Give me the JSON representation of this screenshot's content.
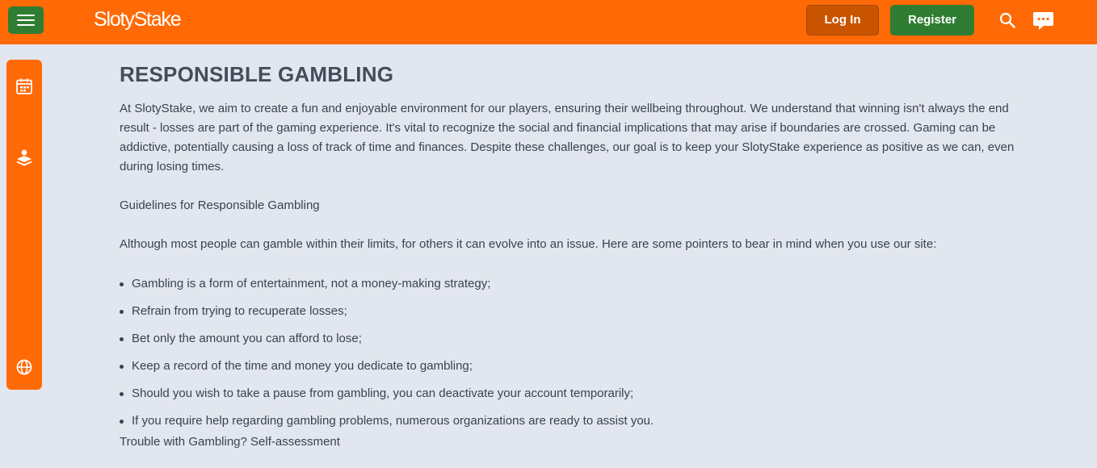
{
  "header": {
    "logo_text": "SlotyStake",
    "login_label": "Log In",
    "register_label": "Register",
    "menu_icon": "hamburger-menu-icon",
    "search_icon": "search-icon",
    "chat_icon": "chat-icon"
  },
  "sidebar": {
    "items": [
      {
        "icon": "calendar-icon"
      },
      {
        "icon": "casino-chips-icon"
      },
      {
        "icon": "globe-icon"
      }
    ]
  },
  "main": {
    "title": "RESPONSIBLE GAMBLING",
    "intro": "At SlotyStake, we aim to create a fun and enjoyable environment for our players, ensuring their wellbeing throughout. We understand that winning isn't always the end result - losses are part of the gaming experience. It's vital to recognize the social and financial implications that may arise if boundaries are crossed. Gaming can be addictive, potentially causing a loss of track of time and finances. Despite these challenges, our goal is to keep your SlotyStake experience as positive as we can, even during losing times.",
    "guidelines_heading": "Guidelines for Responsible Gambling",
    "guidelines_intro": "Although most people can gamble within their limits, for others it can evolve into an issue. Here are some pointers to bear in mind when you use our site:",
    "pointers": [
      "Gambling is a form of entertainment, not a money-making strategy;",
      "Refrain from trying to recuperate losses;",
      "Bet only the amount you can afford to lose;",
      "Keep a record of the time and money you dedicate to gambling;",
      "Should you wish to take a pause from gambling, you can deactivate your account temporarily;",
      "If you require help regarding gambling problems, numerous organizations are ready to assist you."
    ],
    "trouble_heading": "Trouble with Gambling? Self-assessment"
  },
  "colors": {
    "brand_orange": "#ff6a06",
    "accent_green": "#2f7d32",
    "login_orange": "#c95400",
    "page_background": "#e2e6ee",
    "text": "#3c4151"
  }
}
